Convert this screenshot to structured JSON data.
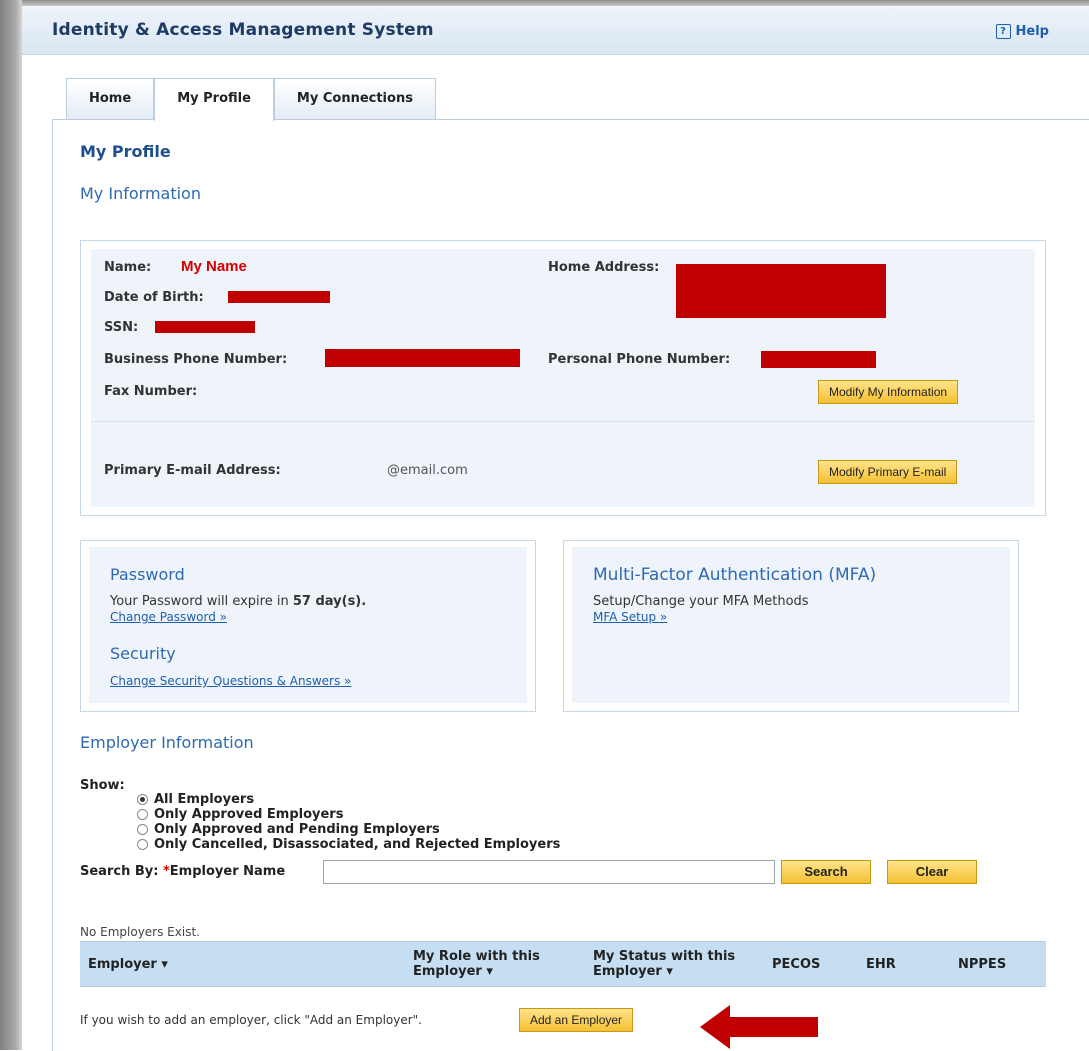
{
  "header": {
    "app_title": "Identity & Access Management System",
    "help_label": "Help"
  },
  "tabs": [
    {
      "label": "Home",
      "active": false
    },
    {
      "label": "My Profile",
      "active": true
    },
    {
      "label": "My Connections",
      "active": false
    }
  ],
  "profile": {
    "title": "My Profile",
    "info_title": "My Information",
    "fields": {
      "name_label": "Name:",
      "name_value": "My Name",
      "dob_label": "Date of Birth:",
      "ssn_label": "SSN:",
      "business_phone_label": "Business Phone Number:",
      "fax_label": "Fax Number:",
      "home_address_label": "Home Address:",
      "personal_phone_label": "Personal Phone Number:",
      "email_label": "Primary E-mail Address:",
      "email_value": "@email.com"
    },
    "modify_info_button": "Modify My Information",
    "modify_email_button": "Modify Primary E-mail"
  },
  "password": {
    "title": "Password",
    "expire_prefix": "Your Password will expire in",
    "expire_days": "57 day(s).",
    "change_link": "Change Password »"
  },
  "security": {
    "title": "Security",
    "change_link": "Change Security Questions & Answers »"
  },
  "mfa": {
    "title": "Multi-Factor Authentication (MFA)",
    "text": "Setup/Change your MFA Methods",
    "setup_link": "MFA Setup »"
  },
  "employer": {
    "title": "Employer Information",
    "show_label": "Show:",
    "options": [
      {
        "label": "All Employers",
        "checked": true
      },
      {
        "label": "Only Approved Employers",
        "checked": false
      },
      {
        "label": "Only Approved and Pending Employers",
        "checked": false
      },
      {
        "label": "Only Cancelled, Disassociated, and Rejected Employers",
        "checked": false
      }
    ],
    "search_by_label": "Search By:",
    "search_required": "*",
    "search_field_label": "Employer Name",
    "search_button": "Search",
    "clear_button": "Clear",
    "no_employers": "No Employers Exist.",
    "columns": {
      "employer": "Employer ▾",
      "role_line1": "My Role with this",
      "role_line2": "Employer ▾",
      "status_line1": "My Status with this",
      "status_line2": "Employer ▾",
      "pecos": "PECOS",
      "ehr": "EHR",
      "nppes": "NPPES"
    },
    "add_hint": "If you wish to add an employer, click \"Add an Employer\".",
    "add_button": "Add an Employer"
  },
  "colors": {
    "redaction": "#c00000",
    "heading_blue": "#2e6ab1",
    "button_yellow": "#f5c032",
    "table_header": "#c6def2"
  }
}
